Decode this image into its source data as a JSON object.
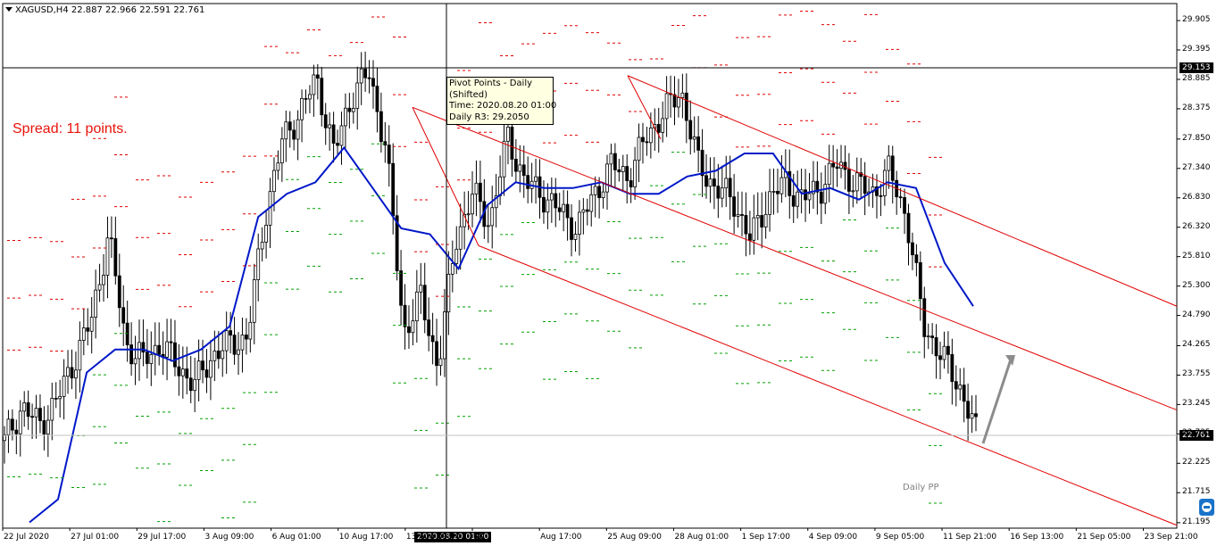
{
  "chart_title": "XAGUSD,H4  22.887 22.966 22.591 22.761",
  "spread_text": "Spread: 11 points.",
  "tooltip": {
    "line1": "Pivot Points - Daily",
    "line2": "(Shifted)",
    "line3": "Time: 2020.08.20 01:00",
    "line4": "Daily R3: 29.2050"
  },
  "daily_pp_label": "Daily PP",
  "crosshair": {
    "price_label": "29.153",
    "time_label": "2020.08.20 01:00"
  },
  "current_price_label": "22.761",
  "colors": {
    "candle": "#000000",
    "ma_line": "#0018c8",
    "channel": "#e00000",
    "pivot_resistance": "#e00000",
    "pivot_support": "#00a000",
    "arrow": "#8c8c8c",
    "spread_text": "#e8140a"
  },
  "icons": {
    "broker_badge": "teamviewer-icon",
    "menu_triangle": "triangle-down-icon"
  },
  "chart_data": {
    "type": "candlestick",
    "symbol": "XAGUSD",
    "timeframe": "H4",
    "ohlc_current": {
      "open": 22.887,
      "high": 22.966,
      "low": 22.591,
      "close": 22.761
    },
    "y_tick_labels": [
      "29.905",
      "29.395",
      "28.885",
      "28.375",
      "27.850",
      "27.340",
      "26.830",
      "26.320",
      "25.810",
      "25.300",
      "24.790",
      "24.265",
      "23.755",
      "23.245",
      "22.735",
      "22.225",
      "21.715",
      "21.195"
    ],
    "x_tick_labels": [
      "22 Jul 2020",
      "27 Jul 01:00",
      "29 Jul 17:00",
      "3 Aug 09:00",
      "6 Aug 01:00",
      "10 Aug 17:00",
      "13 Aug 09:00",
      "18",
      "Aug 17:00",
      "25 Aug 09:00",
      "28 Aug 01:00",
      "1 Sep 17:00",
      "4 Sep 09:00",
      "9 Sep 05:00",
      "11 Sep 21:00",
      "16 Sep 13:00",
      "21 Sep 05:00",
      "23 Sep 21:00"
    ],
    "indicator": "Pivot Points - Daily (Shifted)",
    "pivot_r3_at_crosshair": 29.205,
    "ylim": [
      21.1,
      30.2
    ],
    "grid": false,
    "series": [
      {
        "name": "price",
        "close_path": [
          22.6,
          23.2,
          22.9,
          23.3,
          24.0,
          24.7,
          26.2,
          24.3,
          24.0,
          24.3,
          23.9,
          23.6,
          24.1,
          24.3,
          24.4,
          26.5,
          27.8,
          28.3,
          28.9,
          27.6,
          28.6,
          29.0,
          27.7,
          24.5,
          25.1,
          23.9,
          26.1,
          26.9,
          26.4,
          27.9,
          27.1,
          26.9,
          26.6,
          26.3,
          26.9,
          27.4,
          27.2,
          27.9,
          28.3,
          28.7,
          27.4,
          27.0,
          26.8,
          26.1,
          26.8,
          27.1,
          26.8,
          27.0,
          27.4,
          27.1,
          26.9,
          27.3,
          26.5,
          24.6,
          24.1,
          23.6,
          22.76
        ]
      },
      {
        "name": "ma",
        "path": [
          21.2,
          21.6,
          23.8,
          24.2,
          24.2,
          24.0,
          24.2,
          24.6,
          26.5,
          26.9,
          27.1,
          27.7,
          27.0,
          26.3,
          26.2,
          25.6,
          26.7,
          27.1,
          27.0,
          27.0,
          27.1,
          26.9,
          26.9,
          27.2,
          27.3,
          27.6,
          27.6,
          26.9,
          27.0,
          26.8,
          27.1,
          27.0,
          25.7,
          24.95
        ]
      }
    ]
  }
}
